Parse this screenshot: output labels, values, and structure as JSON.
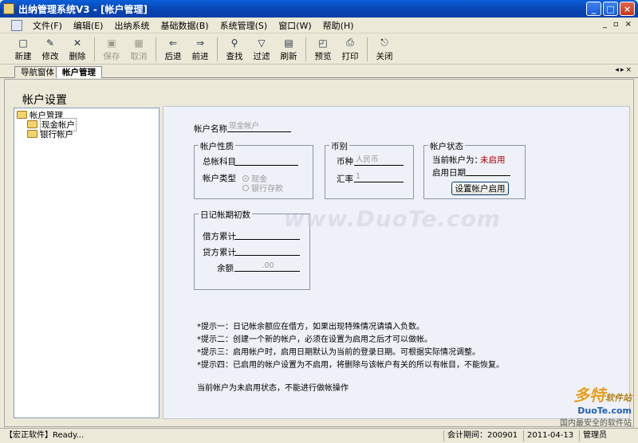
{
  "window": {
    "title": "出纳管理系统V3 - [帐户管理]"
  },
  "menu": [
    "文件(F)",
    "编辑(E)",
    "出纳系统",
    "基础数据(B)",
    "系统管理(S)",
    "窗口(W)",
    "帮助(H)"
  ],
  "menu_window_controls": [
    "_",
    "▫",
    "×"
  ],
  "toolbar": [
    {
      "label": "新建",
      "icon": "new-doc-icon",
      "glyph": "□",
      "enabled": true
    },
    {
      "label": "修改",
      "icon": "edit-icon",
      "glyph": "✎",
      "enabled": true
    },
    {
      "label": "删除",
      "icon": "delete-icon",
      "glyph": "✕",
      "enabled": true
    },
    {
      "label": "保存",
      "icon": "save-icon",
      "glyph": "▣",
      "enabled": false
    },
    {
      "label": "取消",
      "icon": "cancel-icon",
      "glyph": "▦",
      "enabled": false
    },
    {
      "label": "后退",
      "icon": "back-arrow-icon",
      "glyph": "⇐",
      "enabled": true
    },
    {
      "label": "前进",
      "icon": "forward-arrow-icon",
      "glyph": "⇒",
      "enabled": true
    },
    {
      "label": "查找",
      "icon": "binoculars-icon",
      "glyph": "⚲",
      "enabled": true
    },
    {
      "label": "过滤",
      "icon": "filter-icon",
      "glyph": "▽",
      "enabled": true
    },
    {
      "label": "刷新",
      "icon": "refresh-icon",
      "glyph": "▤",
      "enabled": true
    },
    {
      "label": "预览",
      "icon": "preview-icon",
      "glyph": "◰",
      "enabled": true
    },
    {
      "label": "打印",
      "icon": "printer-icon",
      "glyph": "⎙",
      "enabled": true
    },
    {
      "label": "关闭",
      "icon": "close-door-icon",
      "glyph": "⎋",
      "enabled": true
    }
  ],
  "tabs": [
    {
      "label": "导航窗体",
      "active": false
    },
    {
      "label": "帐户管理",
      "active": true
    }
  ],
  "page": {
    "title": "帐户设置"
  },
  "tree": {
    "root": "帐户管理",
    "children": [
      "现金帐户",
      "银行帐户"
    ]
  },
  "form": {
    "account_name_label": "帐户名称",
    "account_name_value": "现金帐户",
    "nature": {
      "title": "帐户性质",
      "ledger_label": "总帐科目",
      "ledger_value": "",
      "type_label": "帐户类型",
      "options": [
        "现金",
        "银行存款"
      ],
      "selected": 0
    },
    "currency": {
      "title": "币别",
      "currency_label": "币种",
      "currency_value": "人民币",
      "rate_label": "汇率",
      "rate_value": "1"
    },
    "status": {
      "title": "帐户状态",
      "current_label": "当前帐户为：",
      "current_value": "未启用",
      "date_label": "启用日期",
      "date_value": "",
      "enable_button": "设置帐户启用"
    },
    "opening": {
      "title": "日记帐期初数",
      "debit_label": "借方累计",
      "debit_value": "",
      "credit_label": "贷方累计",
      "credit_value": "",
      "balance_label": "余额",
      "balance_value": ".00"
    }
  },
  "tips": [
    "*提示一：日记帐余额应在借方，如果出现特殊情况请填入负数。",
    "*提示二：创建一个新的帐户，必须在设置为启用之后才可以做帐。",
    "*提示三：启用帐户时，启用日期默认为当前的登录日期。可根据实际情况调整。",
    "*提示四：已启用的帐户设置为不启用，将删除与该帐户有关的所以有帐目，不能恢复。"
  ],
  "footer_note": "当前帐户为未启用状态，不能进行做帐操作",
  "watermark": {
    "main": "www.DuoTe.com",
    "logo": "多特",
    "logo_sub": "软件站",
    "site": "DuoTe.com",
    "slogan": "国内最安全的软件站"
  },
  "statusbar": {
    "company": "【宏正软件】Ready...",
    "period": "会计期间：200901",
    "date": "2011-04-13",
    "user": "管理员"
  },
  "colors": {
    "title_bar": "#0842b0",
    "status_value": "#b00000"
  }
}
